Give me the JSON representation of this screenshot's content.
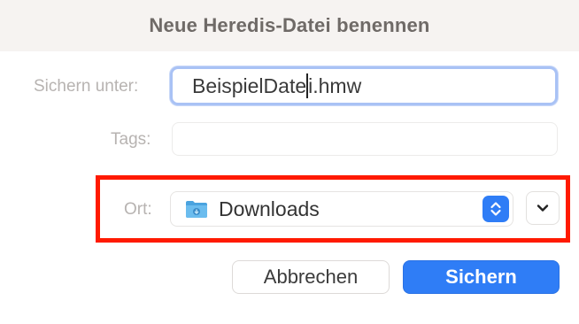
{
  "dialog": {
    "title": "Neue Heredis-Datei benennen"
  },
  "save_as": {
    "label": "Sichern unter:",
    "value_before_caret": "BeispielDate",
    "value_after_caret": "i.hmw"
  },
  "tags": {
    "label": "Tags:",
    "value": ""
  },
  "location": {
    "label": "Ort:",
    "value": "Downloads",
    "icon": "folder-icon"
  },
  "buttons": {
    "cancel_label": "Abbrechen",
    "save_label": "Sichern"
  },
  "colors": {
    "accent": "#2f7df6",
    "highlight": "#ff1a00"
  }
}
